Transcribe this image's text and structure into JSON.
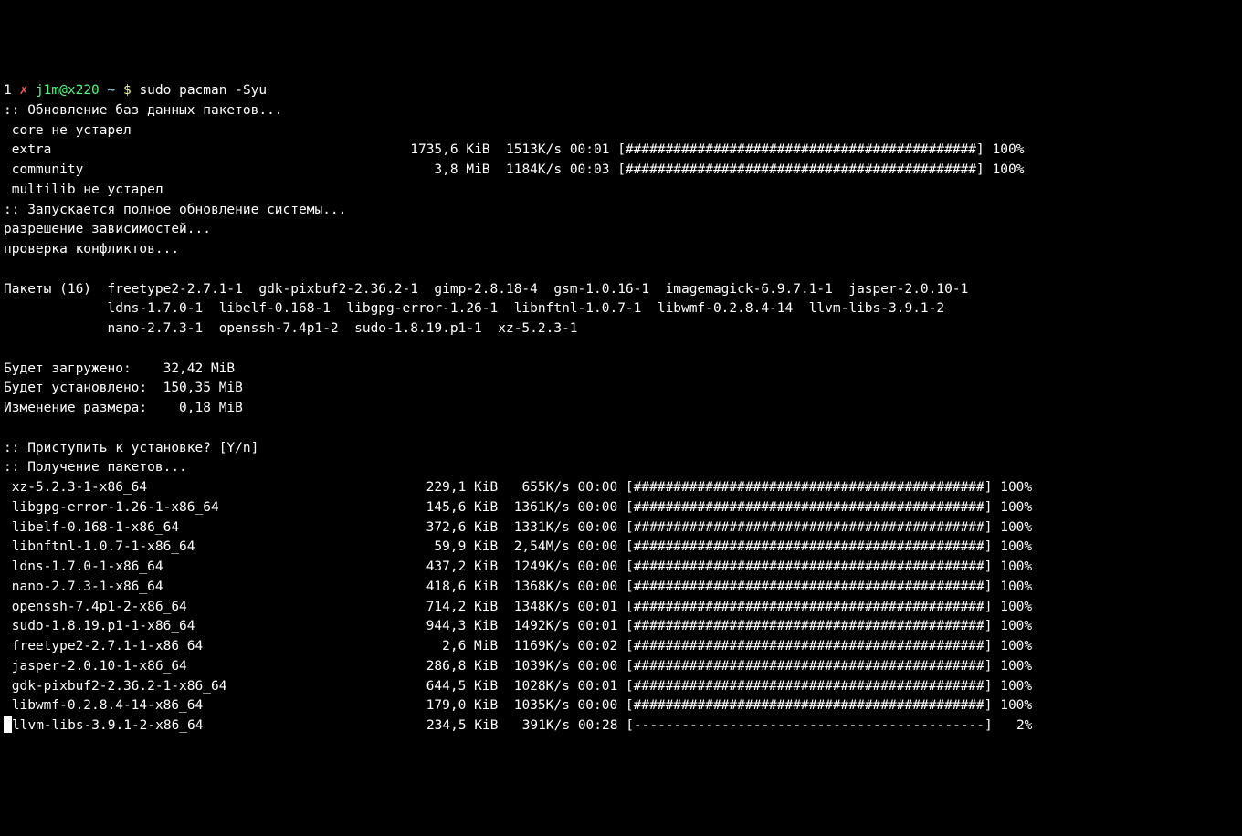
{
  "prompt": {
    "tab_number": "1",
    "x_mark": "✗",
    "user_host": "j1m@x220",
    "cwd": "~",
    "dollar": "$",
    "command": "sudo pacman -Syu"
  },
  "header": {
    "db_update": ":: Обновление баз данных пакетов...",
    "core": " core не устарел",
    "extra_name": " extra",
    "extra_rest": "                                             1735,6 KiB  1513K/s 00:01 [############################################] 100%",
    "community_name": " community",
    "community_rest": "                                            3,8 MiB  1184K/s 00:03 [############################################] 100%",
    "multilib": " multilib не устарел",
    "full_upgrade": ":: Запускается полное обновление системы...",
    "resolving": "разрешение зависимостей...",
    "conflicts": "проверка конфликтов..."
  },
  "packages": {
    "line1": "Пакеты (16)  freetype2-2.7.1-1  gdk-pixbuf2-2.36.2-1  gimp-2.8.18-4  gsm-1.0.16-1  imagemagick-6.9.7.1-1  jasper-2.0.10-1",
    "line2": "             ldns-1.7.0-1  libelf-0.168-1  libgpg-error-1.26-1  libnftnl-1.0.7-1  libwmf-0.2.8.4-14  llvm-libs-3.9.1-2",
    "line3": "             nano-2.7.3-1  openssh-7.4p1-2  sudo-1.8.19.p1-1  xz-5.2.3-1"
  },
  "sizes": {
    "download": "Будет загружено:    32,42 MiB",
    "installed": "Будет установлено:  150,35 MiB",
    "netchange": "Изменение размера:    0,18 MiB"
  },
  "proceed": ":: Приступить к установке? [Y/n] ",
  "retrieving": ":: Получение пакетов...",
  "downloads": [
    {
      "name": " xz-5.2.3-1-x86_64",
      "rest": "                                   229,1 KiB   655K/s 00:00 [############################################] 100%"
    },
    {
      "name": " libgpg-error-1.26-1-x86_64",
      "rest": "                          145,6 KiB  1361K/s 00:00 [############################################] 100%"
    },
    {
      "name": " libelf-0.168-1-x86_64",
      "rest": "                               372,6 KiB  1331K/s 00:00 [############################################] 100%"
    },
    {
      "name": " libnftnl-1.0.7-1-x86_64",
      "rest": "                              59,9 KiB  2,54M/s 00:00 [############################################] 100%"
    },
    {
      "name": " ldns-1.7.0-1-x86_64",
      "rest": "                                 437,2 KiB  1249K/s 00:00 [############################################] 100%"
    },
    {
      "name": " nano-2.7.3-1-x86_64",
      "rest": "                                 418,6 KiB  1368K/s 00:00 [############################################] 100%"
    },
    {
      "name": " openssh-7.4p1-2-x86_64",
      "rest": "                              714,2 KiB  1348K/s 00:01 [############################################] 100%"
    },
    {
      "name": " sudo-1.8.19.p1-1-x86_64",
      "rest": "                             944,3 KiB  1492K/s 00:01 [############################################] 100%"
    },
    {
      "name": " freetype2-2.7.1-1-x86_64",
      "rest": "                              2,6 MiB  1169K/s 00:02 [############################################] 100%"
    },
    {
      "name": " jasper-2.0.10-1-x86_64",
      "rest": "                              286,8 KiB  1039K/s 00:00 [############################################] 100%"
    },
    {
      "name": " gdk-pixbuf2-2.36.2-1-x86_64",
      "rest": "                         644,5 KiB  1028K/s 00:01 [############################################] 100%"
    },
    {
      "name": " libwmf-0.2.8.4-14-x86_64",
      "rest": "                            179,0 KiB  1035K/s 00:00 [############################################] 100%"
    },
    {
      "name": "llvm-libs-3.9.1-2-x86_64",
      "rest": "                            234,5 KiB   391K/s 00:28 [--------------------------------------------]   2%"
    }
  ]
}
